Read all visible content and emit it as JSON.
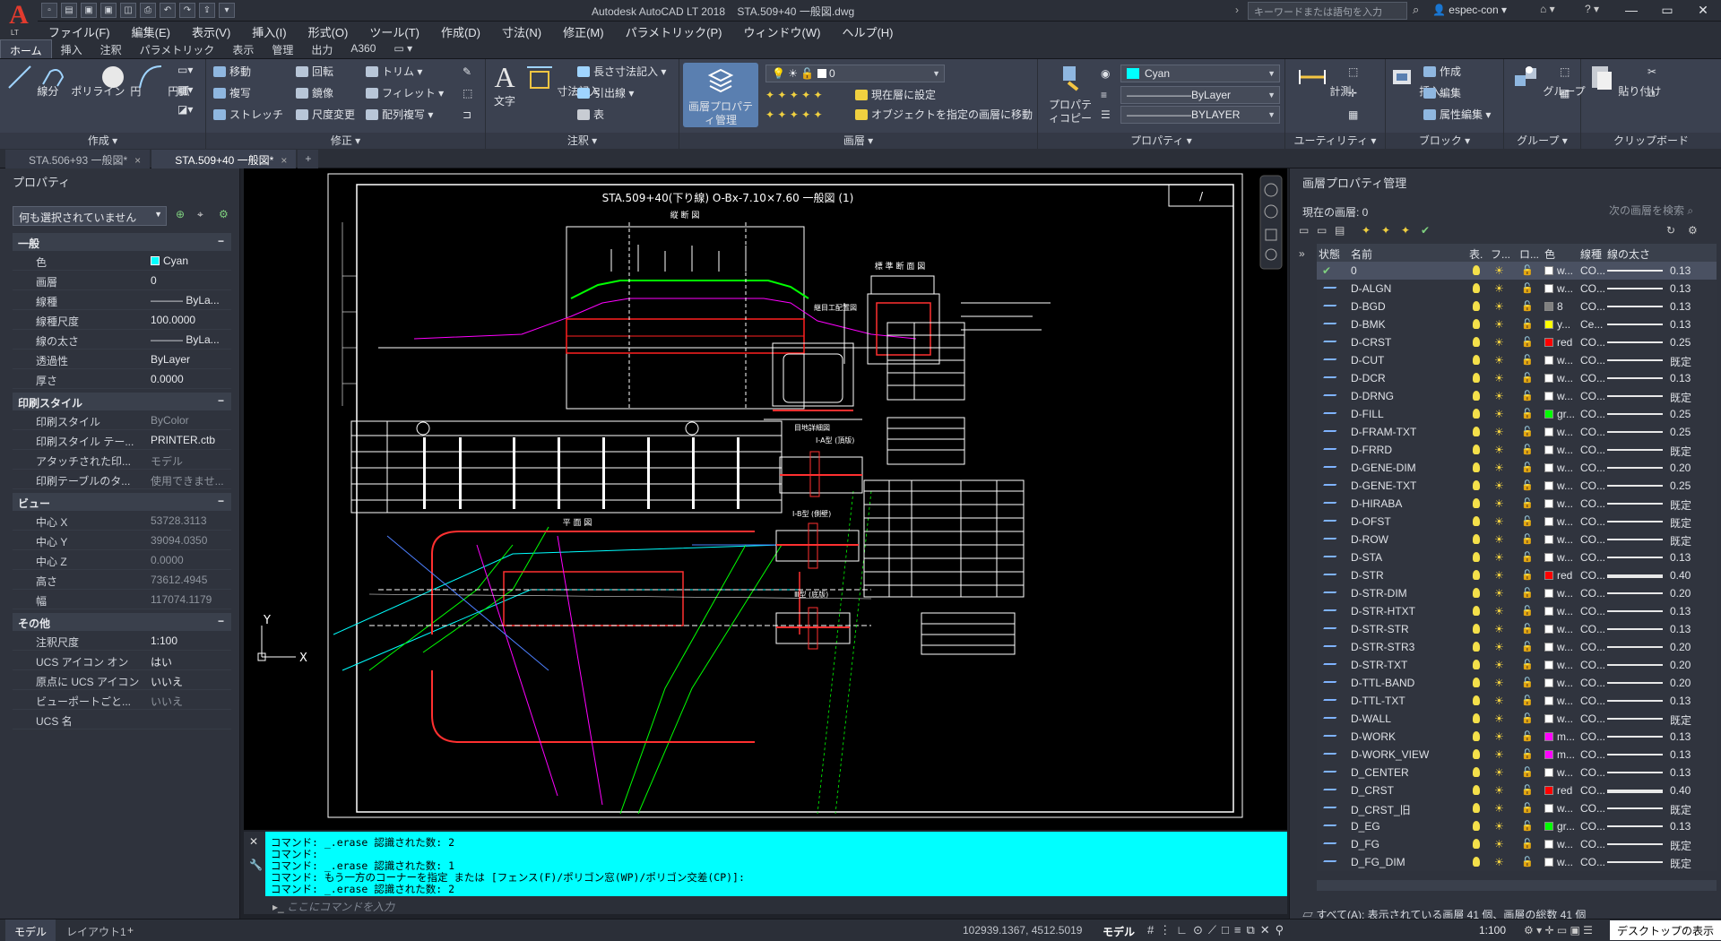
{
  "titlebar": {
    "app_title": "Autodesk AutoCAD LT 2018    STA.509+40 一般図.dwg",
    "search_placeholder": "キーワードまたは語句を入力",
    "user": "espec-con",
    "logo_sub": "LT"
  },
  "menubar": [
    "ファイル(F)",
    "編集(E)",
    "表示(V)",
    "挿入(I)",
    "形式(O)",
    "ツール(T)",
    "作成(D)",
    "寸法(N)",
    "修正(M)",
    "パラメトリック(P)",
    "ウィンドウ(W)",
    "ヘルプ(H)"
  ],
  "ribbon_tabs": [
    "ホーム",
    "挿入",
    "注釈",
    "パラメトリック",
    "表示",
    "管理",
    "出力",
    "A360"
  ],
  "ribbon": {
    "draw": {
      "title": "作成",
      "line": "線分",
      "polyline": "ポリライン",
      "circle": "円",
      "arc": "円弧"
    },
    "modify": {
      "title": "修正",
      "move": "移動",
      "copy": "複写",
      "stretch": "ストレッチ",
      "rotate": "回転",
      "mirror": "鏡像",
      "scale": "尺度変更",
      "trim": "トリム",
      "fillet": "フィレット",
      "array": "配列複写"
    },
    "annotation": {
      "title": "注釈",
      "text": "文字",
      "dimension": "寸法記入",
      "linear": "長さ寸法記入",
      "leader": "引出線",
      "table": "表"
    },
    "layers": {
      "title": "画層",
      "properties": "画層プロパティ管理",
      "current_layer": "0",
      "set_current": "現在層に設定",
      "match_layer": "オブジェクトを指定の画層に移動"
    },
    "properties": {
      "title": "プロパティ",
      "match": "プロパティコピー",
      "color": "Cyan",
      "linetype": "ByLayer",
      "lineweight": "BYLAYER"
    },
    "utilities": {
      "title": "ユーティリティ",
      "measure": "計測"
    },
    "block": {
      "title": "ブロック",
      "insert": "挿入",
      "create": "作成",
      "edit": "編集",
      "attr": "属性編集"
    },
    "groups": {
      "title": "グループ",
      "group": "グループ"
    },
    "clipboard": {
      "title": "クリップボード",
      "paste": "貼り付け"
    }
  },
  "doc_tabs": [
    "STA.506+93 一般図*",
    "STA.509+40 一般図*"
  ],
  "properties_palette": {
    "title": "プロパティ",
    "selection": "何も選択されていません",
    "sections": [
      {
        "name": "一般",
        "rows": [
          [
            "色",
            "Cyan"
          ],
          [
            "画層",
            "0"
          ],
          [
            "線種",
            "——— ByLa..."
          ],
          [
            "線種尺度",
            "100.0000"
          ],
          [
            "線の太さ",
            "——— ByLa..."
          ],
          [
            "透過性",
            "ByLayer"
          ],
          [
            "厚さ",
            "0.0000"
          ]
        ]
      },
      {
        "name": "印刷スタイル",
        "rows": [
          [
            "印刷スタイル",
            "ByColor"
          ],
          [
            "印刷スタイル テー...",
            "PRINTER.ctb"
          ],
          [
            "アタッチされた印...",
            "モデル"
          ],
          [
            "印刷テーブルのタ...",
            "使用できませ..."
          ]
        ]
      },
      {
        "name": "ビュー",
        "rows": [
          [
            "中心 X",
            "53728.3113"
          ],
          [
            "中心 Y",
            "39094.0350"
          ],
          [
            "中心 Z",
            "0.0000"
          ],
          [
            "高さ",
            "73612.4945"
          ],
          [
            "幅",
            "117074.1179"
          ]
        ]
      },
      {
        "name": "その他",
        "rows": [
          [
            "注釈尺度",
            "1:100"
          ],
          [
            "UCS アイコン オン",
            "はい"
          ],
          [
            "原点に UCS アイコン",
            "いいえ"
          ],
          [
            "ビューポートごと...",
            "いいえ"
          ],
          [
            "UCS 名",
            ""
          ]
        ]
      }
    ]
  },
  "drawing": {
    "title": "STA.509+40(下り線) O-Bx-7.10×7.60  一般図 (1)",
    "sheet_no": "/",
    "longitudinal": "縦 断 図",
    "plan": "平 面 図",
    "std_section": "標 準 断 面 図",
    "joint": "継目工配置図",
    "detail1": "Ⅰ-A型 (頂版)",
    "detail2": "Ⅰ-B型 (側壁)",
    "detail3": "Ⅲ型 (底版)",
    "joint_detail": "目地詳細図"
  },
  "command": {
    "lines": [
      "コマンド: _.erase 認識された数: 2",
      "コマンド:",
      "コマンド: _.erase 認識された数: 1",
      "コマンド: もう一方のコーナーを指定 または [フェンス(F)/ポリゴン窓(WP)/ポリゴン交差(CP)]:",
      "コマンド: _.erase 認識された数: 2"
    ],
    "placeholder": "ここにコマンドを入力"
  },
  "layer_manager": {
    "title": "画層プロパティ管理",
    "current": "現在の画層: 0",
    "search": "次の画層を検索",
    "columns": [
      "状態",
      "名前",
      "表.",
      "フ...",
      "ロ...",
      "色",
      "線種",
      "線の太さ"
    ],
    "rows": [
      {
        "name": "0",
        "color": "w...",
        "hex": "#ffffff",
        "lt": "CO...",
        "lw": "0.13",
        "sel": true
      },
      {
        "name": "D-ALGN",
        "color": "w...",
        "hex": "#ffffff",
        "lt": "CO...",
        "lw": "0.13"
      },
      {
        "name": "D-BGD",
        "color": "8",
        "hex": "#808080",
        "lt": "CO...",
        "lw": "0.13"
      },
      {
        "name": "D-BMK",
        "color": "y...",
        "hex": "#ffff00",
        "lt": "Ce...",
        "lw": "0.13"
      },
      {
        "name": "D-CRST",
        "color": "red",
        "hex": "#ff0000",
        "lt": "CO...",
        "lw": "0.25"
      },
      {
        "name": "D-CUT",
        "color": "w...",
        "hex": "#ffffff",
        "lt": "CO...",
        "lw": "既定"
      },
      {
        "name": "D-DCR",
        "color": "w...",
        "hex": "#ffffff",
        "lt": "CO...",
        "lw": "0.13"
      },
      {
        "name": "D-DRNG",
        "color": "w...",
        "hex": "#ffffff",
        "lt": "CO...",
        "lw": "既定"
      },
      {
        "name": "D-FILL",
        "color": "gr...",
        "hex": "#00ff00",
        "lt": "CO...",
        "lw": "0.25"
      },
      {
        "name": "D-FRAM-TXT",
        "color": "w...",
        "hex": "#ffffff",
        "lt": "CO...",
        "lw": "0.25"
      },
      {
        "name": "D-FRRD",
        "color": "w...",
        "hex": "#ffffff",
        "lt": "CO...",
        "lw": "既定"
      },
      {
        "name": "D-GENE-DIM",
        "color": "w...",
        "hex": "#ffffff",
        "lt": "CO...",
        "lw": "0.20"
      },
      {
        "name": "D-GENE-TXT",
        "color": "w...",
        "hex": "#ffffff",
        "lt": "CO...",
        "lw": "0.25"
      },
      {
        "name": "D-HIRABA",
        "color": "w...",
        "hex": "#ffffff",
        "lt": "CO...",
        "lw": "既定"
      },
      {
        "name": "D-OFST",
        "color": "w...",
        "hex": "#ffffff",
        "lt": "CO...",
        "lw": "既定"
      },
      {
        "name": "D-ROW",
        "color": "w...",
        "hex": "#ffffff",
        "lt": "CO...",
        "lw": "既定"
      },
      {
        "name": "D-STA",
        "color": "w...",
        "hex": "#ffffff",
        "lt": "CO...",
        "lw": "0.13"
      },
      {
        "name": "D-STR",
        "color": "red",
        "hex": "#ff0000",
        "lt": "CO...",
        "lw": "0.40"
      },
      {
        "name": "D-STR-DIM",
        "color": "w...",
        "hex": "#ffffff",
        "lt": "CO...",
        "lw": "0.20"
      },
      {
        "name": "D-STR-HTXT",
        "color": "w...",
        "hex": "#ffffff",
        "lt": "CO...",
        "lw": "0.13"
      },
      {
        "name": "D-STR-STR",
        "color": "w...",
        "hex": "#ffffff",
        "lt": "CO...",
        "lw": "0.13"
      },
      {
        "name": "D-STR-STR3",
        "color": "w...",
        "hex": "#ffffff",
        "lt": "CO...",
        "lw": "0.20"
      },
      {
        "name": "D-STR-TXT",
        "color": "w...",
        "hex": "#ffffff",
        "lt": "CO...",
        "lw": "0.20"
      },
      {
        "name": "D-TTL-BAND",
        "color": "w...",
        "hex": "#ffffff",
        "lt": "CO...",
        "lw": "0.20"
      },
      {
        "name": "D-TTL-TXT",
        "color": "w...",
        "hex": "#ffffff",
        "lt": "CO...",
        "lw": "0.13"
      },
      {
        "name": "D-WALL",
        "color": "w...",
        "hex": "#ffffff",
        "lt": "CO...",
        "lw": "既定"
      },
      {
        "name": "D-WORK",
        "color": "m...",
        "hex": "#ff00ff",
        "lt": "CO...",
        "lw": "0.13"
      },
      {
        "name": "D-WORK_VIEW",
        "color": "m...",
        "hex": "#ff00ff",
        "lt": "CO...",
        "lw": "0.13"
      },
      {
        "name": "D_CENTER",
        "color": "w...",
        "hex": "#ffffff",
        "lt": "CO...",
        "lw": "0.13"
      },
      {
        "name": "D_CRST",
        "color": "red",
        "hex": "#ff0000",
        "lt": "CO...",
        "lw": "0.40"
      },
      {
        "name": "D_CRST_旧",
        "color": "w...",
        "hex": "#ffffff",
        "lt": "CO...",
        "lw": "既定"
      },
      {
        "name": "D_EG",
        "color": "gr...",
        "hex": "#00ff00",
        "lt": "CO...",
        "lw": "0.13"
      },
      {
        "name": "D_FG",
        "color": "w...",
        "hex": "#ffffff",
        "lt": "CO...",
        "lw": "既定"
      },
      {
        "name": "D_FG_DIM",
        "color": "w...",
        "hex": "#ffffff",
        "lt": "CO...",
        "lw": "既定"
      }
    ],
    "status": "すべて(A): 表示されている画層 41 個、画層の総数 41 個"
  },
  "statusbar": {
    "model_tab": "モデル",
    "layout_tab": "レイアウト1",
    "coords": "102939.1367, 4512.5019",
    "mode": "モデル",
    "scale": "1:100",
    "desktop": "デスクトップの表示"
  }
}
